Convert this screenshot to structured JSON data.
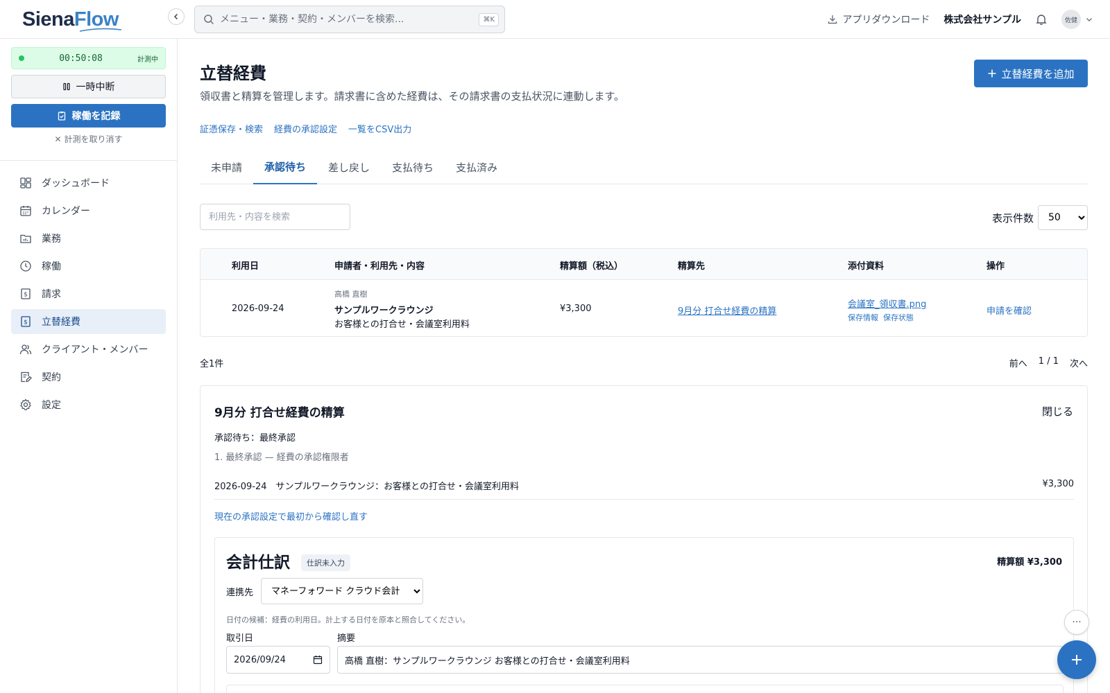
{
  "app": {
    "logo_part1": "Siena",
    "logo_part2": "Flow"
  },
  "search": {
    "placeholder": "メニュー・業務・契約・メンバーを検索...",
    "shortcut": "⌘K"
  },
  "header": {
    "download_label": "アプリダウンロード",
    "company": "株式会社サンプル",
    "avatar_text": "佐健"
  },
  "timer": {
    "time": "00:50:08",
    "status": "計測中",
    "pause_label": "一時中断",
    "record_label": "稼働を記録",
    "cancel_label": "計測を取り消す"
  },
  "sidebar": {
    "items": [
      {
        "label": "ダッシュボード",
        "icon": "dashboard-icon"
      },
      {
        "label": "カレンダー",
        "icon": "calendar-icon"
      },
      {
        "label": "業務",
        "icon": "folder-icon"
      },
      {
        "label": "稼働",
        "icon": "clock-icon"
      },
      {
        "label": "請求",
        "icon": "invoice-icon"
      },
      {
        "label": "立替経費",
        "icon": "expense-icon",
        "active": true
      },
      {
        "label": "クライアント・メンバー",
        "icon": "users-icon"
      },
      {
        "label": "契約",
        "icon": "contract-icon"
      },
      {
        "label": "設定",
        "icon": "gear-icon"
      }
    ]
  },
  "page": {
    "title": "立替経費",
    "subtitle": "領収書と精算を管理します。請求書に含めた経費は、その請求書の支払状況に連動します。",
    "add_label": "立替経費を追加",
    "links": [
      "証憑保存・検索",
      "経費の承認設定",
      "一覧をCSV出力"
    ]
  },
  "tabs": [
    {
      "label": "未申請"
    },
    {
      "label": "承認待ち",
      "active": true
    },
    {
      "label": "差し戻し"
    },
    {
      "label": "支払待ち"
    },
    {
      "label": "支払済み"
    }
  ],
  "filter": {
    "placeholder": "利用先・内容を検索",
    "count_label": "表示件数",
    "count_value": "50"
  },
  "table": {
    "headers": [
      "利用日",
      "申請者・利用先・内容",
      "精算額（税込）",
      "精算先",
      "添付資料",
      "操作"
    ],
    "rows": [
      {
        "date": "2026-09-24",
        "applicant": "高橋 直樹",
        "vendor": "サンプルワークラウンジ",
        "description": "お客様との打合せ・会議室利用料",
        "amount": "¥3,300",
        "settlement": "9月分 打合せ経費の精算",
        "attachment": "会議室_領収書.png",
        "attachment_meta1": "保存情報",
        "attachment_meta2": "保存状態",
        "action": "申請を確認"
      }
    ]
  },
  "pagination": {
    "total": "全1件",
    "prev": "前へ",
    "page": "1 / 1",
    "next": "次へ"
  },
  "detail": {
    "title": "9月分 打合せ経費の精算",
    "close_label": "閉じる",
    "status": "承認待ち：最終承認",
    "step": "1. 最終承認 — 経費の承認権限者",
    "line_desc": "2026-09-24　サンプルワークラウンジ：お客様との打合せ・会議室利用料",
    "line_amount": "¥3,300",
    "recheck_label": "現在の承認設定で最初から確認し直す"
  },
  "accounting": {
    "title": "会計仕訳",
    "badge": "仕訳未入力",
    "amount_label": "精算額 ¥3,300",
    "partner_label": "連携先",
    "partner_value": "マネーフォワード クラウド会計",
    "hint": "日付の候補：経費の利用日。計上する日付を原本と照合してください。",
    "date_label": "取引日",
    "date_value": "2026/09/24",
    "summary_label": "摘要",
    "summary_value": "高橋 直樹：サンプルワークラウンジ お客様との打合せ・会議室利用料"
  },
  "fab": {
    "more_label": "···"
  },
  "colors": {
    "primary": "#2b73c2",
    "timer_bg": "#dcfce7",
    "nav_active_bg": "#e8eff8"
  }
}
